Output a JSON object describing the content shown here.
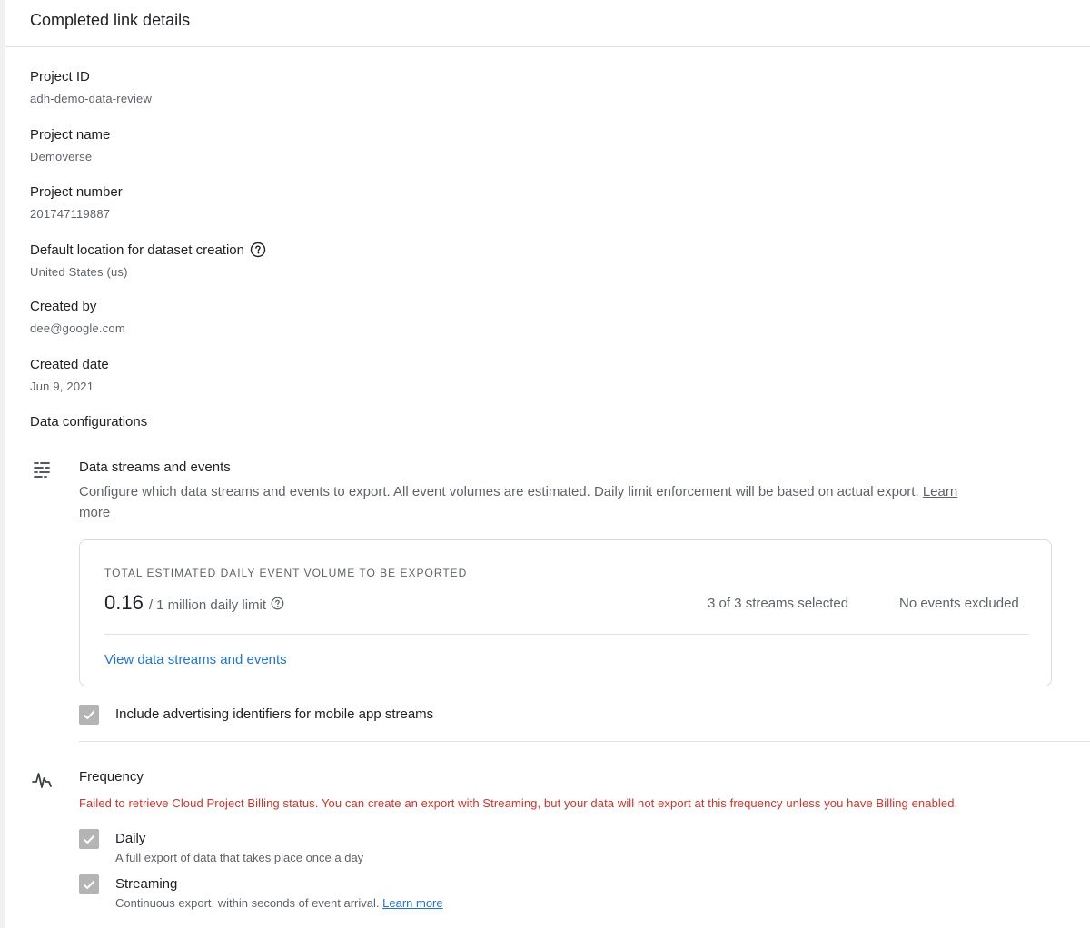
{
  "header": {
    "title": "Completed link details"
  },
  "fields": [
    {
      "label": "Project ID",
      "value": "adh-demo-data-review"
    },
    {
      "label": "Project name",
      "value": "Demoverse"
    },
    {
      "label": "Project number",
      "value": "201747119887"
    },
    {
      "label": "Default location for dataset creation",
      "value": "United States (us)",
      "help_icon": "help-circle-icon"
    },
    {
      "label": "Created by",
      "value": "dee@google.com"
    },
    {
      "label": "Created date",
      "value": "Jun 9, 2021"
    }
  ],
  "data_configurations": {
    "heading": "Data configurations",
    "streams": {
      "icon": "data-streams-icon",
      "title": "Data streams and events",
      "description": "Configure which data streams and events to export. All event volumes are estimated. Daily limit enforcement will be based on actual export.",
      "learn_more": "Learn more",
      "card": {
        "heading": "TOTAL ESTIMATED DAILY EVENT VOLUME TO BE EXPORTED",
        "value": "0.16",
        "limit": "/ 1 million daily limit",
        "streams_selected": "3 of 3 streams selected",
        "events_excluded": "No events excluded",
        "view_link": "View data streams and events"
      },
      "ad_identifiers": {
        "label": "Include advertising identifiers for mobile app streams",
        "checked": true
      }
    },
    "frequency": {
      "icon": "frequency-pulse-icon",
      "title": "Frequency",
      "error": "Failed to retrieve Cloud Project Billing status. You can create an export with Streaming, but your data will not export at this frequency unless you have Billing enabled.",
      "options": [
        {
          "label": "Daily",
          "description": "A full export of data that takes place once a day",
          "checked": true
        },
        {
          "label": "Streaming",
          "description": "Continuous export, within seconds of event arrival.",
          "learn_more": "Learn more",
          "checked": true
        }
      ]
    }
  },
  "colors": {
    "link": "#1a73e8",
    "error": "#d93025",
    "checkbox_disabled": "#b4b4b4"
  }
}
